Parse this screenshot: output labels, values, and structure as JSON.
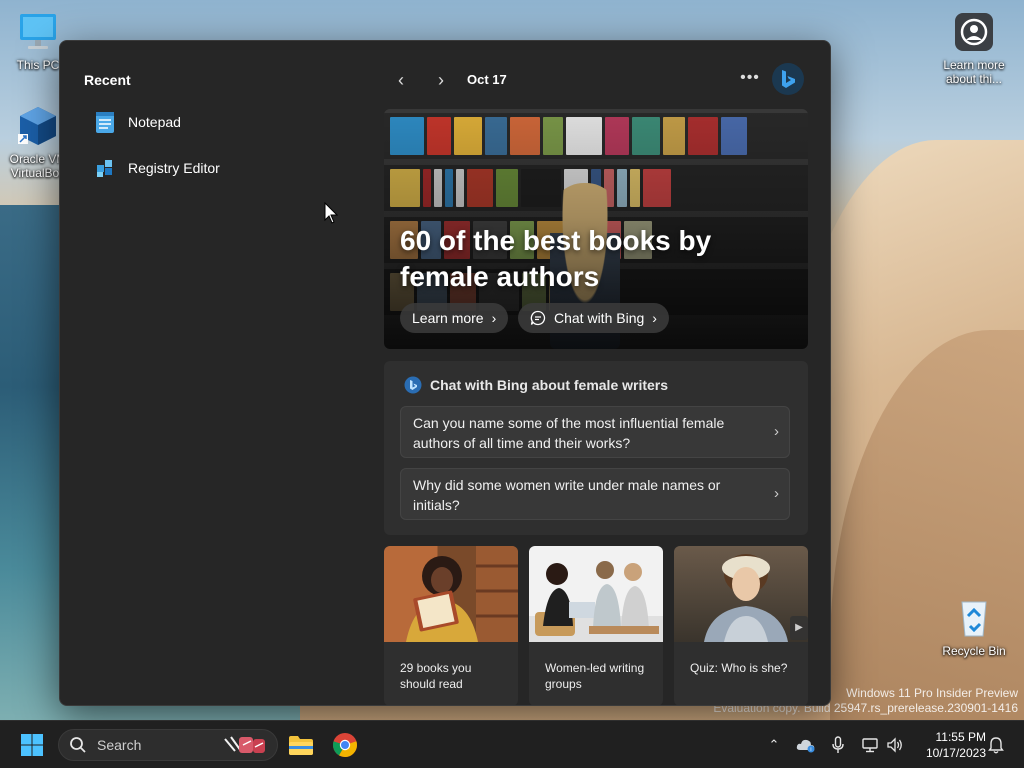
{
  "desktop": {
    "icons": [
      {
        "label": "This PC"
      },
      {
        "label": "Oracle VM VirtualBox"
      },
      {
        "label": "Learn more about thi..."
      },
      {
        "label": "Recycle Bin"
      }
    ],
    "watermark_line1": "Windows 11 Pro Insider Preview",
    "watermark_line2": "Evaluation copy. Build 25947.rs_prerelease.230901-1416"
  },
  "panel": {
    "recent_title": "Recent",
    "recent_items": [
      {
        "label": "Notepad",
        "icon": "notepad-icon"
      },
      {
        "label": "Registry Editor",
        "icon": "registry-editor-icon"
      }
    ],
    "nav_date": "Oct 17",
    "hero": {
      "title": "60 of the best books by female authors",
      "learn_more": "Learn more",
      "chat_with_bing": "Chat with Bing"
    },
    "chat": {
      "heading": "Chat with Bing about female writers",
      "questions": [
        "Can you name some of the most influential female authors of all time and their works?",
        "Why did some women write under male names or initials?"
      ]
    },
    "cards": [
      {
        "title": "29 books you should read"
      },
      {
        "title": "Women-led writing groups"
      },
      {
        "title": "Quiz: Who is she?"
      }
    ]
  },
  "taskbar": {
    "search_placeholder": "Search",
    "time": "11:55 PM",
    "date": "10/17/2023"
  },
  "colors": {
    "panel_bg": "#262626",
    "card_bg": "#2f2f2f",
    "taskbar_bg": "#202020",
    "accent_blue": "#0a84d8"
  }
}
